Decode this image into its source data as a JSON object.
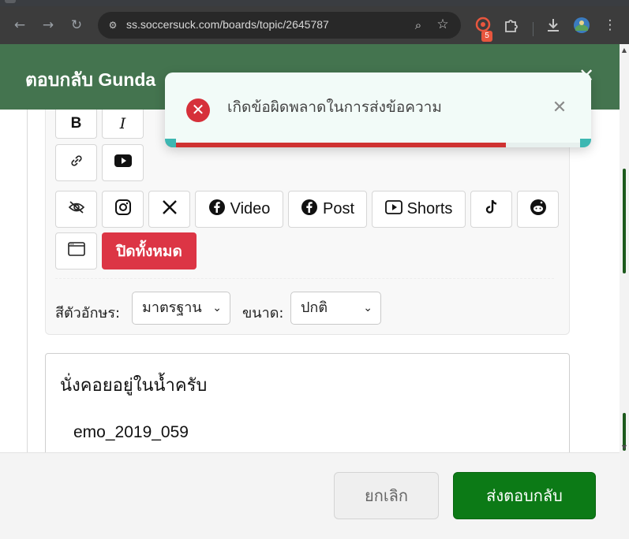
{
  "browser": {
    "url": "ss.soccersuck.com/boards/topic/2645787",
    "extension_badge": "5"
  },
  "modal": {
    "title": "ตอบกลับ Gunda"
  },
  "editor": {
    "buttons": {
      "bold": "B",
      "italic": "I",
      "video_label": "Video",
      "post_label": "Post",
      "shorts_label": "Shorts",
      "close_all": "ปิดทั้งหมด"
    },
    "font_color_label": "สีตัวอักษร:",
    "font_color_value": "มาตรฐาน",
    "size_label": "ขนาด:",
    "size_value": "ปกติ",
    "content_line1": "นั่งคอยอยู่ในน้ำครับ",
    "content_line2": "emo_2019_059"
  },
  "footer": {
    "cancel_label": "ยกเลิก",
    "send_label": "ส่งตอบกลับ"
  },
  "toast": {
    "message": "เกิดข้อผิดพลาดในการส่งข้อความ",
    "progress": 0.8
  },
  "colors": {
    "header_green": "#44744f",
    "send_green": "#0c7a16",
    "danger_red": "#dc3545",
    "toast_bg": "#f2fbf8"
  }
}
